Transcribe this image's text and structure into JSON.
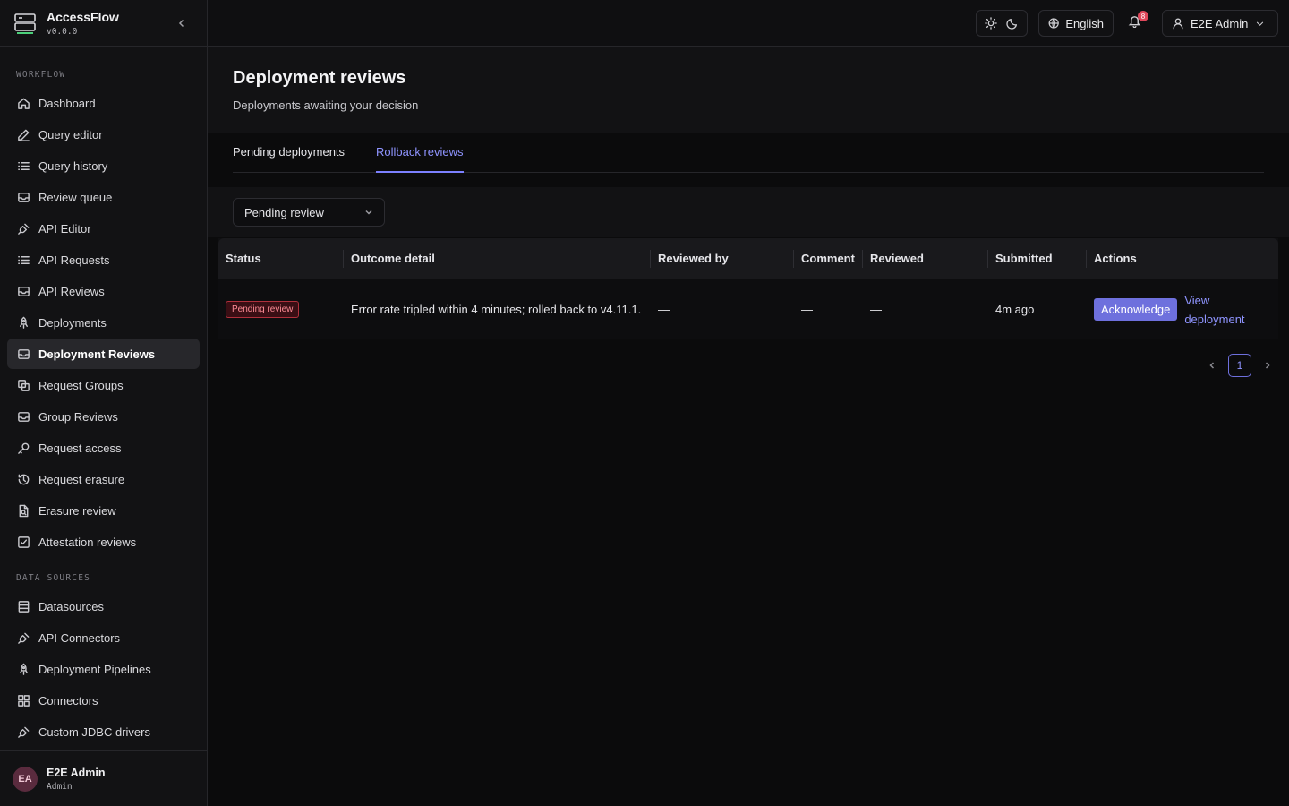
{
  "app": {
    "name": "AccessFlow",
    "version": "v0.0.0"
  },
  "sidebar": {
    "sections": [
      {
        "label": "WORKFLOW",
        "items": [
          {
            "label": "Dashboard",
            "icon": "home-icon"
          },
          {
            "label": "Query editor",
            "icon": "pencil-icon"
          },
          {
            "label": "Query history",
            "icon": "list-icon"
          },
          {
            "label": "Review queue",
            "icon": "inbox-icon"
          },
          {
            "label": "API Editor",
            "icon": "plug-icon"
          },
          {
            "label": "API Requests",
            "icon": "list-icon"
          },
          {
            "label": "API Reviews",
            "icon": "inbox-icon"
          },
          {
            "label": "Deployments",
            "icon": "rocket-icon"
          },
          {
            "label": "Deployment Reviews",
            "icon": "inbox-icon",
            "active": true
          },
          {
            "label": "Request Groups",
            "icon": "group-icon"
          },
          {
            "label": "Group Reviews",
            "icon": "inbox-icon"
          },
          {
            "label": "Request access",
            "icon": "key-icon"
          },
          {
            "label": "Request erasure",
            "icon": "history-icon"
          },
          {
            "label": "Erasure review",
            "icon": "file-search-icon"
          },
          {
            "label": "Attestation reviews",
            "icon": "check-square-icon"
          }
        ]
      },
      {
        "label": "DATA SOURCES",
        "items": [
          {
            "label": "Datasources",
            "icon": "database-icon"
          },
          {
            "label": "API Connectors",
            "icon": "plug-icon"
          },
          {
            "label": "Deployment Pipelines",
            "icon": "rocket-icon"
          },
          {
            "label": "Connectors",
            "icon": "grid-icon"
          },
          {
            "label": "Custom JDBC drivers",
            "icon": "plug-icon"
          }
        ]
      }
    ],
    "user": {
      "initials": "EA",
      "name": "E2E Admin",
      "role": "Admin"
    }
  },
  "topbar": {
    "language": "English",
    "notifications_count": "8",
    "user_label": "E2E Admin"
  },
  "page": {
    "title": "Deployment reviews",
    "subtitle": "Deployments awaiting your decision",
    "tabs": [
      "Pending deployments",
      "Rollback reviews"
    ],
    "active_tab": "Rollback reviews",
    "filter": {
      "selected": "Pending review"
    }
  },
  "table": {
    "columns": [
      "Status",
      "Outcome detail",
      "Reviewed by",
      "Comment",
      "Reviewed",
      "Submitted",
      "Actions"
    ],
    "rows": [
      {
        "status": "Pending review",
        "outcome": "Error rate tripled within 4 minutes; rolled back to v4.11.1.",
        "reviewed_by": "—",
        "comment": "—",
        "reviewed": "—",
        "submitted": "4m ago",
        "action_primary": "Acknowledge",
        "action_link_1": "View",
        "action_link_2": "deployment"
      }
    ]
  },
  "pagination": {
    "current": "1"
  },
  "colors": {
    "accent": "#6e70dd",
    "danger": "#b0303c",
    "bg": "#0b0b0c"
  }
}
